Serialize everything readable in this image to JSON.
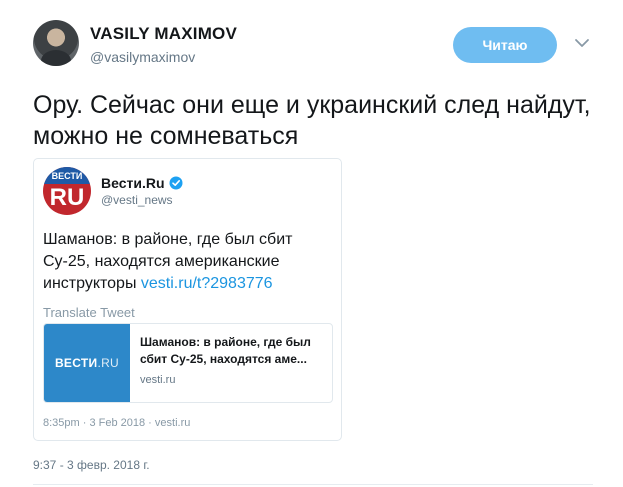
{
  "author": {
    "name": "VASILY MAXIMOV",
    "handle": "@vasilymaximov"
  },
  "follow_button": {
    "label": "Читаю",
    "color": "#6fbdf1"
  },
  "tweet": {
    "text": "Ору. Сейчас они еще и украинский след найдут, можно не сомневаться",
    "timestamp": "9:37 - 3 февр. 2018 г."
  },
  "quoted": {
    "avatar_top": "ВЕСТИ",
    "avatar_bottom": "RU",
    "name": "Вести.Ru",
    "handle": "@vesti_news",
    "text": "Шаманов: в районе, где был сбит Су-25, находятся американские инструкторы ",
    "link_text": "vesti.ru/t?2983776",
    "translate_label": "Translate Tweet",
    "card": {
      "thumb_brand": "ВЕСТИ",
      "thumb_suffix": ".RU",
      "title": "Шаманов: в районе, где был сбит Су-25, находятся аме...",
      "domain": "vesti.ru"
    },
    "meta": "8:35pm · 3 Feb 2018 · vesti.ru"
  }
}
